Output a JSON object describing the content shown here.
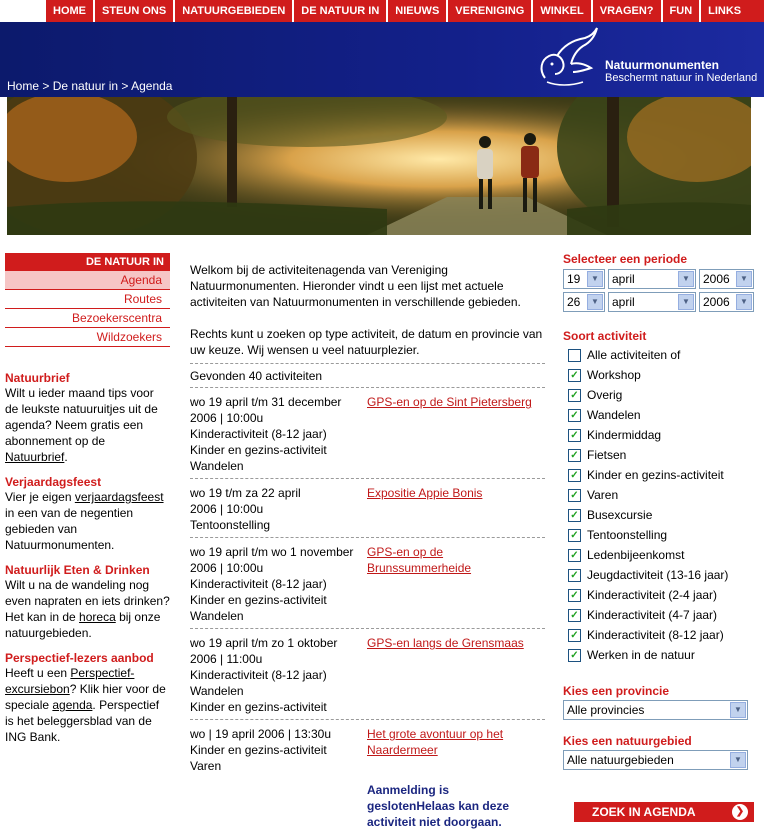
{
  "topnav": [
    "HOME",
    "STEUN ONS",
    "NATUURGEBIEDEN",
    "DE NATUUR IN",
    "NIEUWS",
    "VERENIGING",
    "WINKEL",
    "VRAGEN?",
    "FUN",
    "LINKS"
  ],
  "header": {
    "breadcrumb": [
      "Home",
      " > ",
      "De natuur in",
      " > ",
      "Agenda"
    ],
    "brand": "Natuurmonumenten",
    "tagline": "Beschermt natuur in Nederland"
  },
  "sidebar": {
    "heading": "DE NATUUR IN",
    "items": [
      "Agenda",
      "Routes",
      "Bezoekerscentra",
      "Wildzoekers"
    ],
    "natuurbrief": {
      "title": "Natuurbrief",
      "text": "Wilt u ieder maand tips voor de leukste natuuruitjes uit de agenda? Neem gratis een abonnement op de ",
      "link": "Natuurbrief",
      "after": "."
    },
    "verjaardag": {
      "title": "Verjaardagsfeest",
      "text": "Vier je eigen ",
      "link": "verjaardagsfeest",
      "after": " in een van de negentien gebieden van Natuurmonumenten."
    },
    "eten": {
      "title": "Natuurlijk Eten & Drinken",
      "text": "Wilt u na de wandeling nog even napraten en iets drinken? Het kan in de ",
      "link": "horeca",
      "after": " bij onze natuurgebieden."
    },
    "perspectief": {
      "title": "Perspectief-lezers aanbod",
      "text1": "Heeft u een ",
      "link1": "Perspectief-excursiebon",
      "text2": "? Klik hier voor de speciale ",
      "link2": "agenda",
      "text3": ". Perspectief is het beleggersblad van de ING Bank."
    }
  },
  "main": {
    "intro1": "Welkom bij de activiteitenagenda van Vereniging Natuurmonumenten. Hieronder vindt u een lijst met actuele activiteiten van Natuurmonumenten in verschillende gebieden.",
    "intro2": "Rechts kunt u zoeken op type activiteit, de datum en provincie van uw keuze. Wij wensen u veel natuurplezier.",
    "found": "Gevonden 40 activiteiten",
    "activities": [
      {
        "lines": [
          "wo 19 april t/m 31 december",
          "2006 | 10:00u",
          "Kinderactiviteit (8-12 jaar)",
          "Kinder en gezins-activiteit",
          "Wandelen"
        ],
        "title": "GPS-en op de Sint Pietersberg"
      },
      {
        "lines": [
          "wo 19 t/m za 22 april",
          "2006 | 10:00u",
          "Tentoonstelling"
        ],
        "title": "Expositie Appie Bonis"
      },
      {
        "lines": [
          "wo 19 april t/m wo 1 november",
          "2006 | 10:00u",
          "Kinderactiviteit (8-12 jaar)",
          "Kinder en gezins-activiteit",
          "Wandelen"
        ],
        "title": "GPS-en op de Brunssummerheide"
      },
      {
        "lines": [
          "wo 19 april t/m zo 1 oktober",
          "2006 | 11:00u",
          "Kinderactiviteit (8-12 jaar)",
          "Wandelen",
          "Kinder en gezins-activiteit"
        ],
        "title": "GPS-en langs de Grensmaas"
      },
      {
        "lines": [
          "wo | 19 april 2006 | 13:30u",
          "Kinder en gezins-activiteit",
          "Varen"
        ],
        "title": "Het grote avontuur op het Naardermeer"
      }
    ],
    "closed_note": "Aanmelding is geslotenHelaas kan deze activiteit niet doorgaan."
  },
  "filters": {
    "period_heading": "Selecteer een periode",
    "from": {
      "day": "19",
      "month": "april",
      "year": "2006"
    },
    "to": {
      "day": "26",
      "month": "april",
      "year": "2006"
    },
    "type_heading": "Soort activiteit",
    "types": [
      {
        "label": "Alle activiteiten of",
        "checked": false
      },
      {
        "label": "Workshop",
        "checked": true
      },
      {
        "label": "Overig",
        "checked": true
      },
      {
        "label": "Wandelen",
        "checked": true
      },
      {
        "label": "Kindermiddag",
        "checked": true
      },
      {
        "label": "Fietsen",
        "checked": true
      },
      {
        "label": "Kinder en gezins-activiteit",
        "checked": true
      },
      {
        "label": "Varen",
        "checked": true
      },
      {
        "label": "Busexcursie",
        "checked": true
      },
      {
        "label": "Tentoonstelling",
        "checked": true
      },
      {
        "label": "Ledenbijeenkomst",
        "checked": true
      },
      {
        "label": "Jeugdactiviteit (13-16 jaar)",
        "checked": true
      },
      {
        "label": "Kinderactiviteit (2-4 jaar)",
        "checked": true
      },
      {
        "label": "Kinderactiviteit (4-7 jaar)",
        "checked": true
      },
      {
        "label": "Kinderactiviteit (8-12 jaar)",
        "checked": true
      },
      {
        "label": "Werken in de natuur",
        "checked": true
      }
    ],
    "province_heading": "Kies een provincie",
    "province_value": "Alle provincies",
    "area_heading": "Kies een natuurgebied",
    "area_value": "Alle natuurgebieden",
    "search_button": "ZOEK IN AGENDA"
  },
  "colors": {
    "accent": "#d01c1c",
    "header": "#13208a",
    "closed": "#1b2680"
  }
}
